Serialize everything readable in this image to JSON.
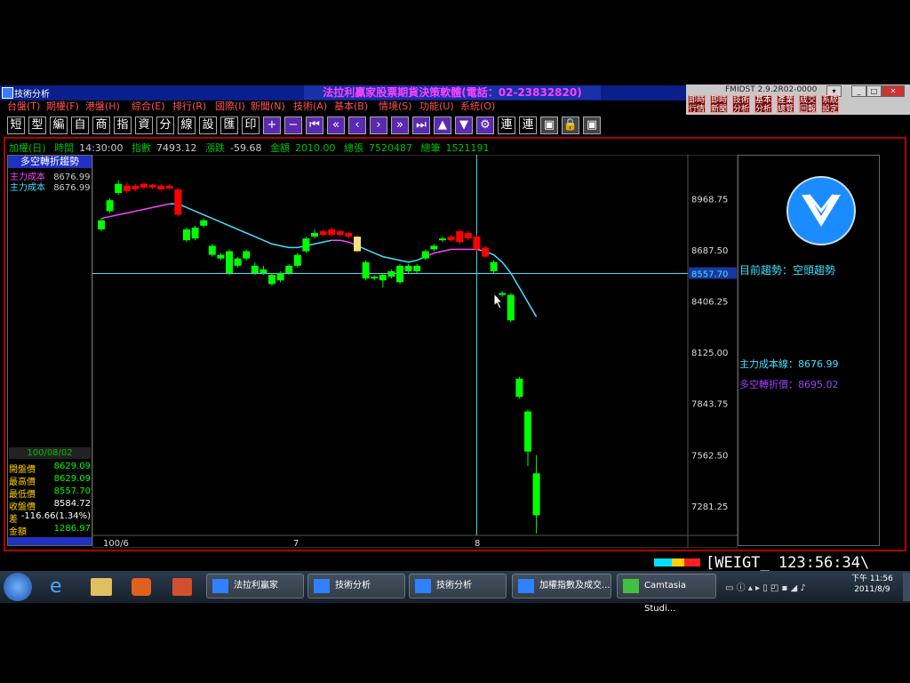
{
  "window": {
    "title": "技術分析",
    "banner": "法拉利贏家股票期貨決策軟體(電話：02-23832820)",
    "sys_label": "FMIDST 2.9.2R02-0000",
    "quick_buttons": [
      "即時行情",
      "即時新聞",
      "技術分析",
      "基本分析",
      "產業總覽",
      "成交回報",
      "系統設定"
    ]
  },
  "menu": [
    "台盤(T)",
    "期權(F)",
    "港盤(H)",
    "綜合(E)",
    "排行(R)",
    "國際(I)",
    "新聞(N)",
    "技術(A)",
    "基本(B)",
    "情境(S)",
    "功能(U)",
    "系統(O)"
  ],
  "toolbar": {
    "text_buttons": [
      "短",
      "型",
      "編",
      "自",
      "商",
      "指",
      "資",
      "分",
      "線",
      "設",
      "匯",
      "印"
    ],
    "icon_buttons": [
      "plus-icon",
      "minus-icon",
      "skip-back-icon",
      "rewind-icon",
      "prev-icon",
      "next-icon",
      "fast-forward-icon",
      "skip-end-icon",
      "up-icon",
      "down-icon",
      "settings-icon"
    ],
    "text_buttons2": [
      "連",
      "連"
    ]
  },
  "info": {
    "symbol": "加權(日)",
    "time_label": "時間",
    "time": "14:30:00",
    "index_label": "指數",
    "index": "7493.12",
    "change_label": "漲跌",
    "change": "-59.68",
    "amount_label": "金額",
    "amount": "2010.00",
    "vol_label": "總張",
    "vol": "7520487",
    "count_label": "總筆",
    "count": "1521191"
  },
  "left_panel": {
    "title": "多空轉折趨勢",
    "cost1_label": "主力成本",
    "cost1": "8676.99↓",
    "cost2_label": "主力成本",
    "cost2": "8676.99↓"
  },
  "ohlc": {
    "date": "100/08/02",
    "rows": [
      {
        "label": "開盤價",
        "value": "8629.09",
        "color": "#00ff00"
      },
      {
        "label": "最高價",
        "value": "8629.09",
        "color": "#00ff00"
      },
      {
        "label": "最低價",
        "value": "8557.70",
        "color": "#00ff00"
      },
      {
        "label": "收盤價",
        "value": "8584.72",
        "color": "#ffffff"
      },
      {
        "label": "差",
        "value": "-116.66(1.34%)",
        "color": "#ffffff"
      },
      {
        "label": "金額",
        "value": "1286.97",
        "color": "#00ff00"
      }
    ]
  },
  "right_panel": {
    "trend_label": "目前趨勢：空頭趨勢",
    "cost_line": "主力成本線：8676.99",
    "pivot": "多空轉折價：8695.02"
  },
  "chart_data": {
    "type": "candlestick",
    "y_ticks": [
      "8968.75",
      "8687.50",
      "8557.70",
      "8406.25",
      "8125.00",
      "7843.75",
      "7562.50",
      "7281.25"
    ],
    "x_ticks": [
      "100/6",
      "7",
      "8"
    ],
    "ylim": [
      7100,
      9200
    ],
    "crosshair_price": 8557.7,
    "candles": [
      {
        "o": 8800,
        "c": 8850,
        "h": 8860,
        "l": 8790
      },
      {
        "o": 8900,
        "c": 8960,
        "h": 8970,
        "l": 8890
      },
      {
        "o": 9000,
        "c": 9050,
        "h": 9070,
        "l": 8990
      },
      {
        "o": 9040,
        "c": 9010,
        "h": 9060,
        "l": 9000
      },
      {
        "o": 9040,
        "c": 9020,
        "h": 9050,
        "l": 9010
      },
      {
        "o": 9050,
        "c": 9030,
        "h": 9060,
        "l": 9020
      },
      {
        "o": 9045,
        "c": 9030,
        "h": 9050,
        "l": 9020
      },
      {
        "o": 9040,
        "c": 9020,
        "h": 9050,
        "l": 9010
      },
      {
        "o": 9040,
        "c": 9025,
        "h": 9050,
        "l": 9015
      },
      {
        "o": 9020,
        "c": 8880,
        "h": 9030,
        "l": 8870
      },
      {
        "o": 8740,
        "c": 8800,
        "h": 8810,
        "l": 8730
      },
      {
        "o": 8750,
        "c": 8810,
        "h": 8820,
        "l": 8740
      },
      {
        "o": 8820,
        "c": 8850,
        "h": 8860,
        "l": 8810
      },
      {
        "o": 8660,
        "c": 8710,
        "h": 8720,
        "l": 8650
      },
      {
        "o": 8640,
        "c": 8660,
        "h": 8670,
        "l": 8630
      },
      {
        "o": 8560,
        "c": 8680,
        "h": 8690,
        "l": 8550
      },
      {
        "o": 8600,
        "c": 8640,
        "h": 8650,
        "l": 8590
      },
      {
        "o": 8640,
        "c": 8680,
        "h": 8690,
        "l": 8630
      },
      {
        "o": 8560,
        "c": 8600,
        "h": 8620,
        "l": 8550
      },
      {
        "o": 8560,
        "c": 8580,
        "h": 8600,
        "l": 8550
      },
      {
        "o": 8500,
        "c": 8550,
        "h": 8560,
        "l": 8490
      },
      {
        "o": 8520,
        "c": 8560,
        "h": 8570,
        "l": 8510
      },
      {
        "o": 8560,
        "c": 8600,
        "h": 8610,
        "l": 8550
      },
      {
        "o": 8600,
        "c": 8660,
        "h": 8670,
        "l": 8590
      },
      {
        "o": 8680,
        "c": 8750,
        "h": 8760,
        "l": 8670
      },
      {
        "o": 8760,
        "c": 8780,
        "h": 8800,
        "l": 8750
      },
      {
        "o": 8790,
        "c": 8770,
        "h": 8800,
        "l": 8760
      },
      {
        "o": 8800,
        "c": 8770,
        "h": 8810,
        "l": 8760
      },
      {
        "o": 8790,
        "c": 8770,
        "h": 8800,
        "l": 8760
      },
      {
        "o": 8780,
        "c": 8760,
        "h": 8790,
        "l": 8750
      },
      {
        "o": 8760,
        "c": 8680,
        "h": 8770,
        "l": 8670
      },
      {
        "o": 8530,
        "c": 8620,
        "h": 8630,
        "l": 8520
      },
      {
        "o": 8530,
        "c": 8540,
        "h": 8550,
        "l": 8520
      },
      {
        "o": 8520,
        "c": 8550,
        "h": 8560,
        "l": 8480
      },
      {
        "o": 8540,
        "c": 8570,
        "h": 8580,
        "l": 8530
      },
      {
        "o": 8510,
        "c": 8600,
        "h": 8610,
        "l": 8500
      },
      {
        "o": 8570,
        "c": 8600,
        "h": 8610,
        "l": 8560
      },
      {
        "o": 8570,
        "c": 8600,
        "h": 8610,
        "l": 8560
      },
      {
        "o": 8640,
        "c": 8680,
        "h": 8690,
        "l": 8630
      },
      {
        "o": 8690,
        "c": 8710,
        "h": 8720,
        "l": 8680
      },
      {
        "o": 8740,
        "c": 8750,
        "h": 8760,
        "l": 8730
      },
      {
        "o": 8760,
        "c": 8740,
        "h": 8770,
        "l": 8730
      },
      {
        "o": 8790,
        "c": 8730,
        "h": 8800,
        "l": 8720
      },
      {
        "o": 8780,
        "c": 8750,
        "h": 8790,
        "l": 8740
      },
      {
        "o": 8760,
        "c": 8690,
        "h": 8770,
        "l": 8680
      },
      {
        "o": 8700,
        "c": 8650,
        "h": 8710,
        "l": 8640
      },
      {
        "o": 8570,
        "c": 8620,
        "h": 8630,
        "l": 8560
      },
      {
        "o": 8440,
        "c": 8450,
        "h": 8460,
        "l": 8430
      },
      {
        "o": 8300,
        "c": 8440,
        "h": 8450,
        "l": 8290
      },
      {
        "o": 7880,
        "c": 7980,
        "h": 7990,
        "l": 7870
      },
      {
        "o": 7580,
        "c": 7800,
        "h": 7810,
        "l": 7500
      },
      {
        "o": 7230,
        "c": 7460,
        "h": 7560,
        "l": 7130
      }
    ],
    "ma": [
      8860,
      8870,
      8880,
      8890,
      8900,
      8910,
      8920,
      8930,
      8940,
      8940,
      8920,
      8900,
      8880,
      8860,
      8840,
      8820,
      8800,
      8780,
      8760,
      8740,
      8720,
      8710,
      8700,
      8700,
      8710,
      8720,
      8730,
      8740,
      8740,
      8730,
      8710,
      8690,
      8670,
      8650,
      8640,
      8630,
      8620,
      8630,
      8650,
      8670,
      8680,
      8690,
      8690,
      8690,
      8690,
      8680,
      8660,
      8620,
      8560,
      8480,
      8400,
      8320
    ],
    "colors": {
      "up": "#00ff00",
      "down": "#ff0000",
      "ma_pink": "#ff40ff",
      "ma_cyan": "#40e0ff"
    }
  },
  "statusbar": {
    "weight_text": "[WEIGT_ 123:56:34\\"
  },
  "taskbar": {
    "tasks": [
      "法拉利贏家",
      "技術分析",
      "技術分析",
      "加權指數及成交...",
      "Camtasia Studi..."
    ],
    "time": "下午 11:56",
    "date": "2011/8/9"
  }
}
